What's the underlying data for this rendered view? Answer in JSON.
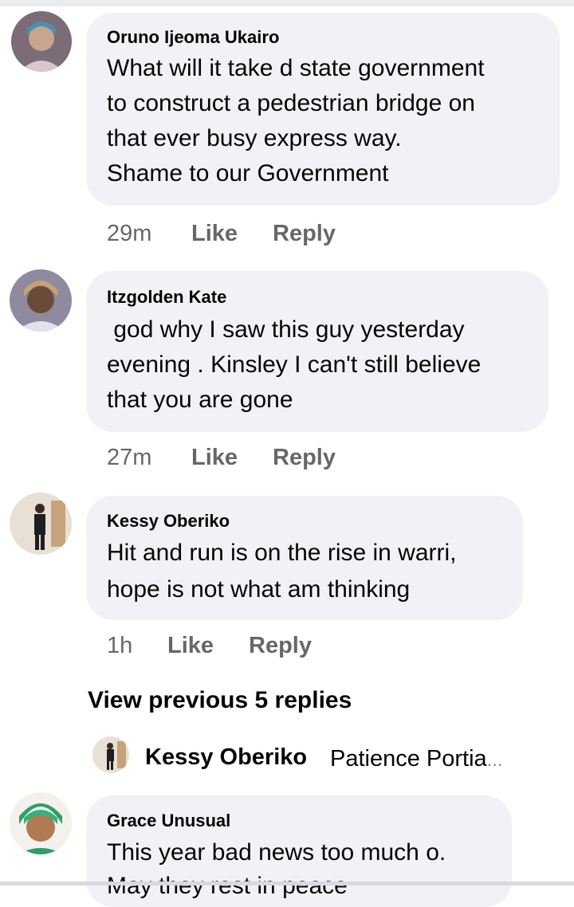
{
  "comments": [
    {
      "author": "Oruno Ijeoma Ukairo",
      "lines": [
        "What will it take d state government",
        "to construct a pedestrian bridge on",
        "that ever busy express way.",
        "Shame to our Government"
      ],
      "time": "29m",
      "like_label": "Like",
      "reply_label": "Reply",
      "avatar_icon": "profile-photo-woman"
    },
    {
      "author": "Itzgolden Kate",
      "lines": [
        " god why I saw this guy yesterday",
        "evening . Kinsley I can't still believe",
        "that you are gone"
      ],
      "time": "27m",
      "like_label": "Like",
      "reply_label": "Reply",
      "avatar_icon": "profile-photo-woman-braids"
    },
    {
      "author": "Kessy Oberiko",
      "lines": [
        "Hit and run is on the rise in warri,",
        "hope is not what am thinking"
      ],
      "time": "1h",
      "like_label": "Like",
      "reply_label": "Reply",
      "avatar_icon": "profile-photo-man-standing"
    },
    {
      "author": "Grace Unusual",
      "lines": [
        "This year bad news too much o.",
        "May they rest in peace"
      ],
      "avatar_icon": "profile-photo-woman-green-headwrap"
    }
  ],
  "view_previous_label": "View previous 5 replies",
  "latest_reply": {
    "author": "Kessy Oberiko",
    "snippet": "Patience Portia",
    "ellipsis": "...",
    "avatar_icon": "profile-photo-man-standing-small"
  },
  "colors": {
    "bubble": "#f0f2f5",
    "meta_text": "#65676b",
    "primary_text": "#050505"
  }
}
